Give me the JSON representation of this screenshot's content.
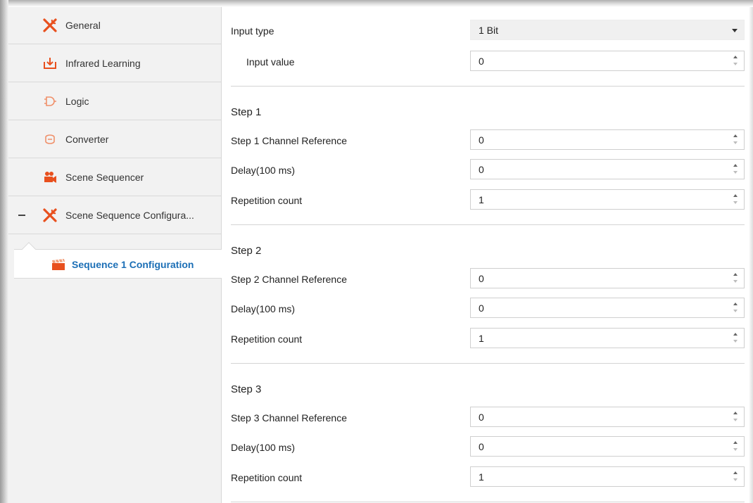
{
  "sidebar": {
    "items": [
      {
        "label": "General",
        "icon": "tools-icon"
      },
      {
        "label": "Infrared Learning",
        "icon": "download-icon"
      },
      {
        "label": "Logic",
        "icon": "logic-gate-icon"
      },
      {
        "label": "Converter",
        "icon": "converter-icon"
      },
      {
        "label": "Scene Sequencer",
        "icon": "camera-icon"
      },
      {
        "label": "Scene Sequence Configura...",
        "icon": "tools-icon"
      }
    ],
    "sub_item": {
      "label": "Sequence 1 Configuration",
      "icon": "clapperboard-icon"
    }
  },
  "main": {
    "input_type": {
      "label": "Input type",
      "value": "1 Bit"
    },
    "input_value": {
      "label": "Input value",
      "value": "0"
    },
    "steps": [
      {
        "title": "Step 1",
        "channel_label": "Step 1 Channel Reference",
        "channel_value": "0",
        "delay_label": "Delay(100 ms)",
        "delay_value": "0",
        "repeat_label": "Repetition count",
        "repeat_value": "1"
      },
      {
        "title": "Step 2",
        "channel_label": "Step 2 Channel Reference",
        "channel_value": "0",
        "delay_label": "Delay(100 ms)",
        "delay_value": "0",
        "repeat_label": "Repetition count",
        "repeat_value": "1"
      },
      {
        "title": "Step 3",
        "channel_label": "Step 3 Channel Reference",
        "channel_value": "0",
        "delay_label": "Delay(100 ms)",
        "delay_value": "0",
        "repeat_label": "Repetition count",
        "repeat_value": "1"
      }
    ]
  },
  "colors": {
    "accent": "#e8501e",
    "selected_text": "#1c6fb6",
    "sidebar_bg": "#f2f2f2"
  }
}
